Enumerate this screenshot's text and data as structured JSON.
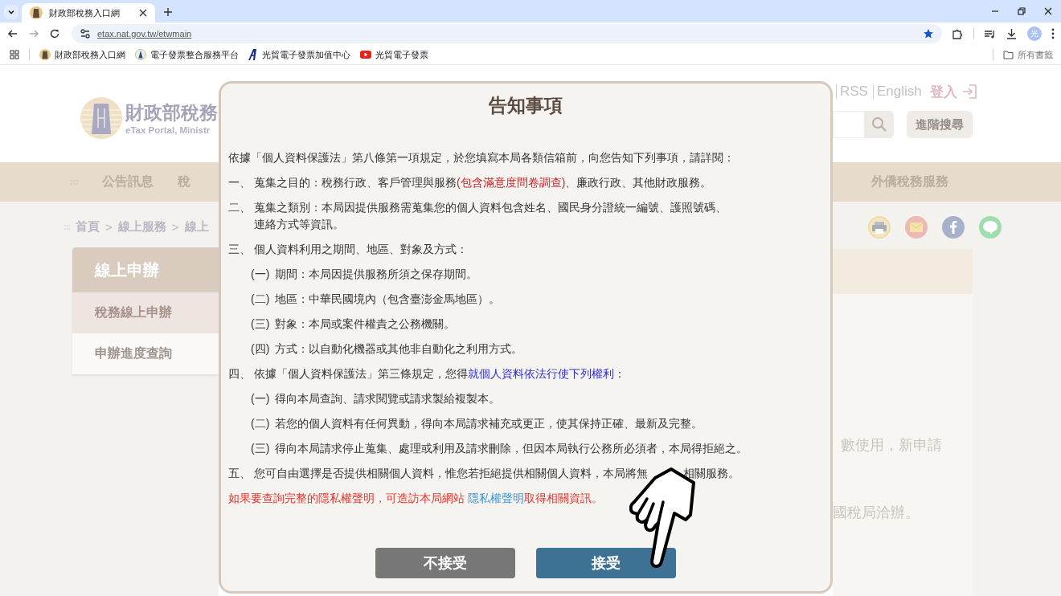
{
  "browser": {
    "tabs": [
      {
        "title": "財政部稅務入口網",
        "selected": true
      }
    ],
    "url": "etax.nat.gov.tw/etwmain",
    "profile": "光",
    "bookmarks": [
      {
        "label": "財政部稅務入口網",
        "kind": "seal"
      },
      {
        "label": "電子發票整合服務平台",
        "kind": "badge"
      },
      {
        "label": "光貿電子發票加值中心",
        "kind": "letter"
      },
      {
        "label": "光貿電子發票",
        "kind": "video"
      }
    ],
    "all_bookmarks": "所有書籤"
  },
  "page": {
    "logo_title": "財政部稅務",
    "logo_subtitle": "eTax Portal, Ministr",
    "nav_left": [
      "公告訊息",
      "稅"
    ],
    "nav_right": [
      "外僑稅務服務"
    ],
    "breadcrumb": [
      {
        "kind": "link",
        "text": "首頁"
      },
      {
        "kind": "separator",
        "text": ">"
      },
      {
        "kind": "link",
        "text": "線上服務"
      },
      {
        "kind": "separator",
        "text": ">"
      },
      {
        "kind": "link",
        "text": "線上"
      }
    ],
    "sidebar": {
      "title": "線上申辦",
      "items": [
        {
          "label": "稅務線上申辦",
          "selected": true
        },
        {
          "label": "申辦進度查詢",
          "selected": false
        }
      ]
    },
    "header_links": [
      "RSS",
      "English"
    ],
    "login": "登入",
    "advanced_search": "進階搜尋",
    "content_lines": [
      "數使用，新申請",
      "國稅局洽辦。"
    ]
  },
  "modal": {
    "title": "告知事項",
    "paragraphs": [
      {
        "kind": "intro",
        "segments": [
          {
            "kind": "plain",
            "text": "依據「個人資料保護法」第八條第一項規定，於您填寫本局各類信箱前，向您告知下列事項，請詳閱："
          }
        ]
      },
      {
        "kind": "item",
        "marker": "一、",
        "segments": [
          {
            "kind": "plain",
            "text": "蒐集之目的：稅務行政、客戶管理與服務"
          },
          {
            "kind": "red",
            "text": "(包含滿意度問卷調查)"
          },
          {
            "kind": "plain",
            "text": "、廉政行政、其他財政服務。"
          }
        ]
      },
      {
        "kind": "item",
        "marker": "二、",
        "segments": [
          {
            "kind": "plain",
            "text": "蒐集之類別：本局因提供服務需蒐集您的個人資料包含姓名、國民身分證統一編號、護照號碼、"
          },
          {
            "kind": "wrapped",
            "text": "連絡方式等資訊。"
          }
        ]
      },
      {
        "kind": "item",
        "marker": "三、",
        "segments": [
          {
            "kind": "plain",
            "text": "個人資料利用之期間、地區、對象及方式："
          }
        ]
      },
      {
        "kind": "sub",
        "marker": "(一)",
        "segments": [
          {
            "kind": "plain",
            "text": "期間：本局因提供服務所須之保存期間。"
          }
        ]
      },
      {
        "kind": "sub",
        "marker": "(二)",
        "segments": [
          {
            "kind": "plain",
            "text": "地區：中華民國境內（包含臺澎金馬地區）。"
          }
        ]
      },
      {
        "kind": "sub",
        "marker": "(三)",
        "segments": [
          {
            "kind": "plain",
            "text": "對象：本局或案件權責之公務機關。"
          }
        ]
      },
      {
        "kind": "sub",
        "marker": "(四)",
        "segments": [
          {
            "kind": "plain",
            "text": "方式：以自動化機器或其他非自動化之利用方式。"
          }
        ]
      },
      {
        "kind": "item",
        "marker": "四、",
        "segments": [
          {
            "kind": "plain",
            "text": "依據「個人資料保護法」第三條規定，您得"
          },
          {
            "kind": "link",
            "text": "就個人資料依法行使下列權利"
          },
          {
            "kind": "plain",
            "text": "："
          }
        ]
      },
      {
        "kind": "sub",
        "marker": "(一)",
        "segments": [
          {
            "kind": "plain",
            "text": "得向本局查詢、請求閱覽或請求製給複製本。"
          }
        ]
      },
      {
        "kind": "sub",
        "marker": "(二)",
        "segments": [
          {
            "kind": "plain",
            "text": "若您的個人資料有任何異動，得向本局請求補充或更正，使其保持正確、最新及完整。"
          }
        ]
      },
      {
        "kind": "sub",
        "marker": "(三)",
        "segments": [
          {
            "kind": "plain",
            "text": "得向本局請求停止蒐集、處理或利用及請求刪除，但因本局執行公務所必須者，本局得拒絕之。"
          }
        ]
      },
      {
        "kind": "item",
        "marker": "五、",
        "segments": [
          {
            "kind": "plain",
            "text": "您可自由選擇是否提供相關個人資料，惟您若拒絕提供相關個人資料，本局將無"
          },
          {
            "kind": "after-cover",
            "text": "相關服務。"
          }
        ]
      },
      {
        "kind": "notice",
        "segments": [
          {
            "kind": "plain",
            "text": "如果要查詢完整的隱私權聲明，可造訪本局網站 "
          },
          {
            "kind": "weblink",
            "text": "隱私權聲明"
          },
          {
            "kind": "plain",
            "text": "取得相關資訊。"
          }
        ]
      }
    ],
    "buttons": [
      {
        "label": "不接受",
        "kind": "decline"
      },
      {
        "label": "接受",
        "kind": "accept"
      }
    ]
  }
}
